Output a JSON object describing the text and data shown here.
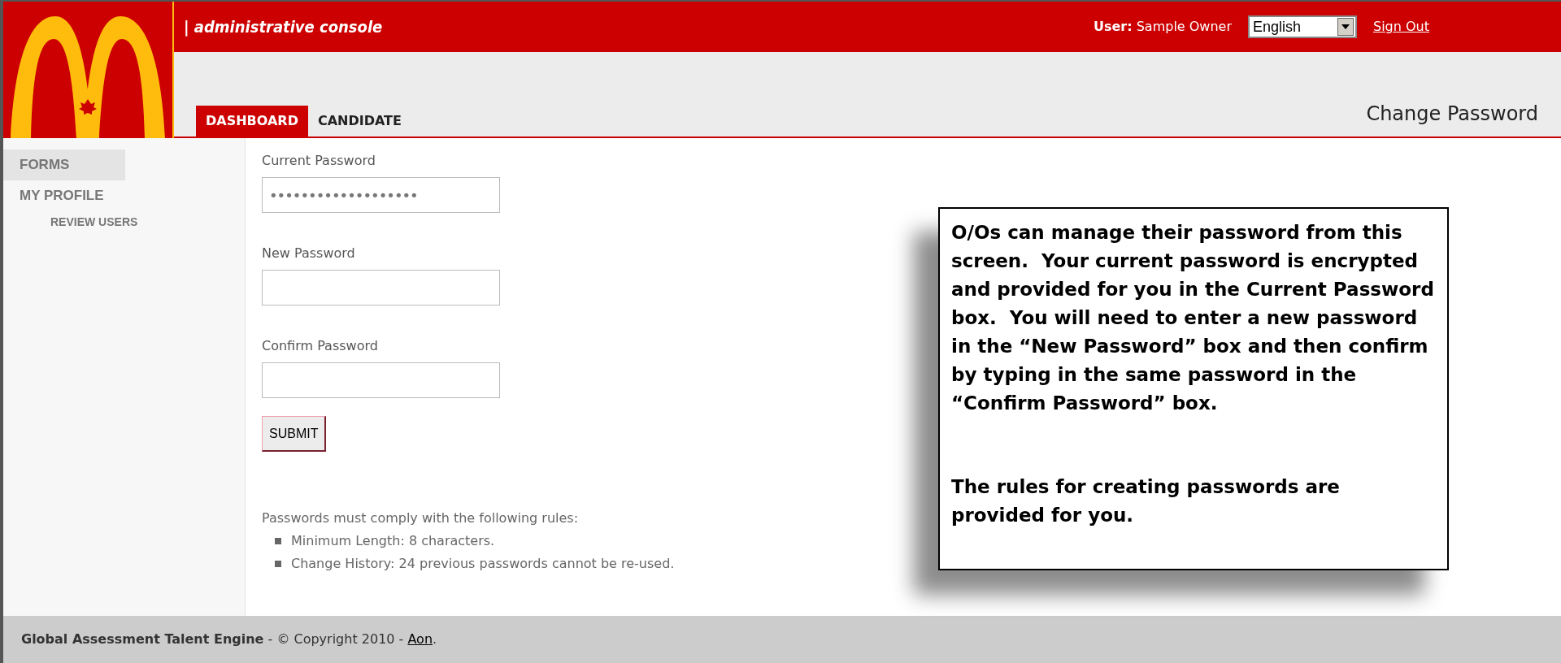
{
  "header": {
    "console_title": "| administrative console",
    "user_label": "User:",
    "user_name": "Sample Owner",
    "language": "English",
    "sign_out": "Sign Out"
  },
  "tabs": [
    {
      "label": "DASHBOARD",
      "selected": true
    },
    {
      "label": "CANDIDATE",
      "selected": false
    }
  ],
  "page_title": "Change Password",
  "sidebar": {
    "items": [
      {
        "label": "FORMS",
        "selected": true
      },
      {
        "label": "MY PROFILE",
        "selected": false,
        "children": [
          {
            "label": "REVIEW USERS",
            "selected": false
          }
        ]
      }
    ]
  },
  "form": {
    "fields": [
      {
        "label": "Current Password",
        "value": "•••••••••••••••••••"
      },
      {
        "label": "New Password"
      },
      {
        "label": "Confirm Password"
      }
    ],
    "submit": "SUBMIT"
  },
  "rules": {
    "intro": "Passwords must comply with the following rules:",
    "items": [
      "Minimum Length: 8 characters.",
      "Change History: 24 previous passwords cannot be re-used."
    ]
  },
  "callout": {
    "paragraphs": [
      "O/Os can manage their password from this screen.  Your current password is encrypted and provided for you in the Current Password box.  You will need to enter a new password in the “New Password” box and then confirm by typing in the same password in the “Confirm Password” box.",
      "The rules for creating passwords are provided for you."
    ]
  },
  "footer": {
    "text": "**Global Assessment Talent Engine** - © Copyright 2010 - ",
    "link": "Aon",
    "suffix": "."
  }
}
